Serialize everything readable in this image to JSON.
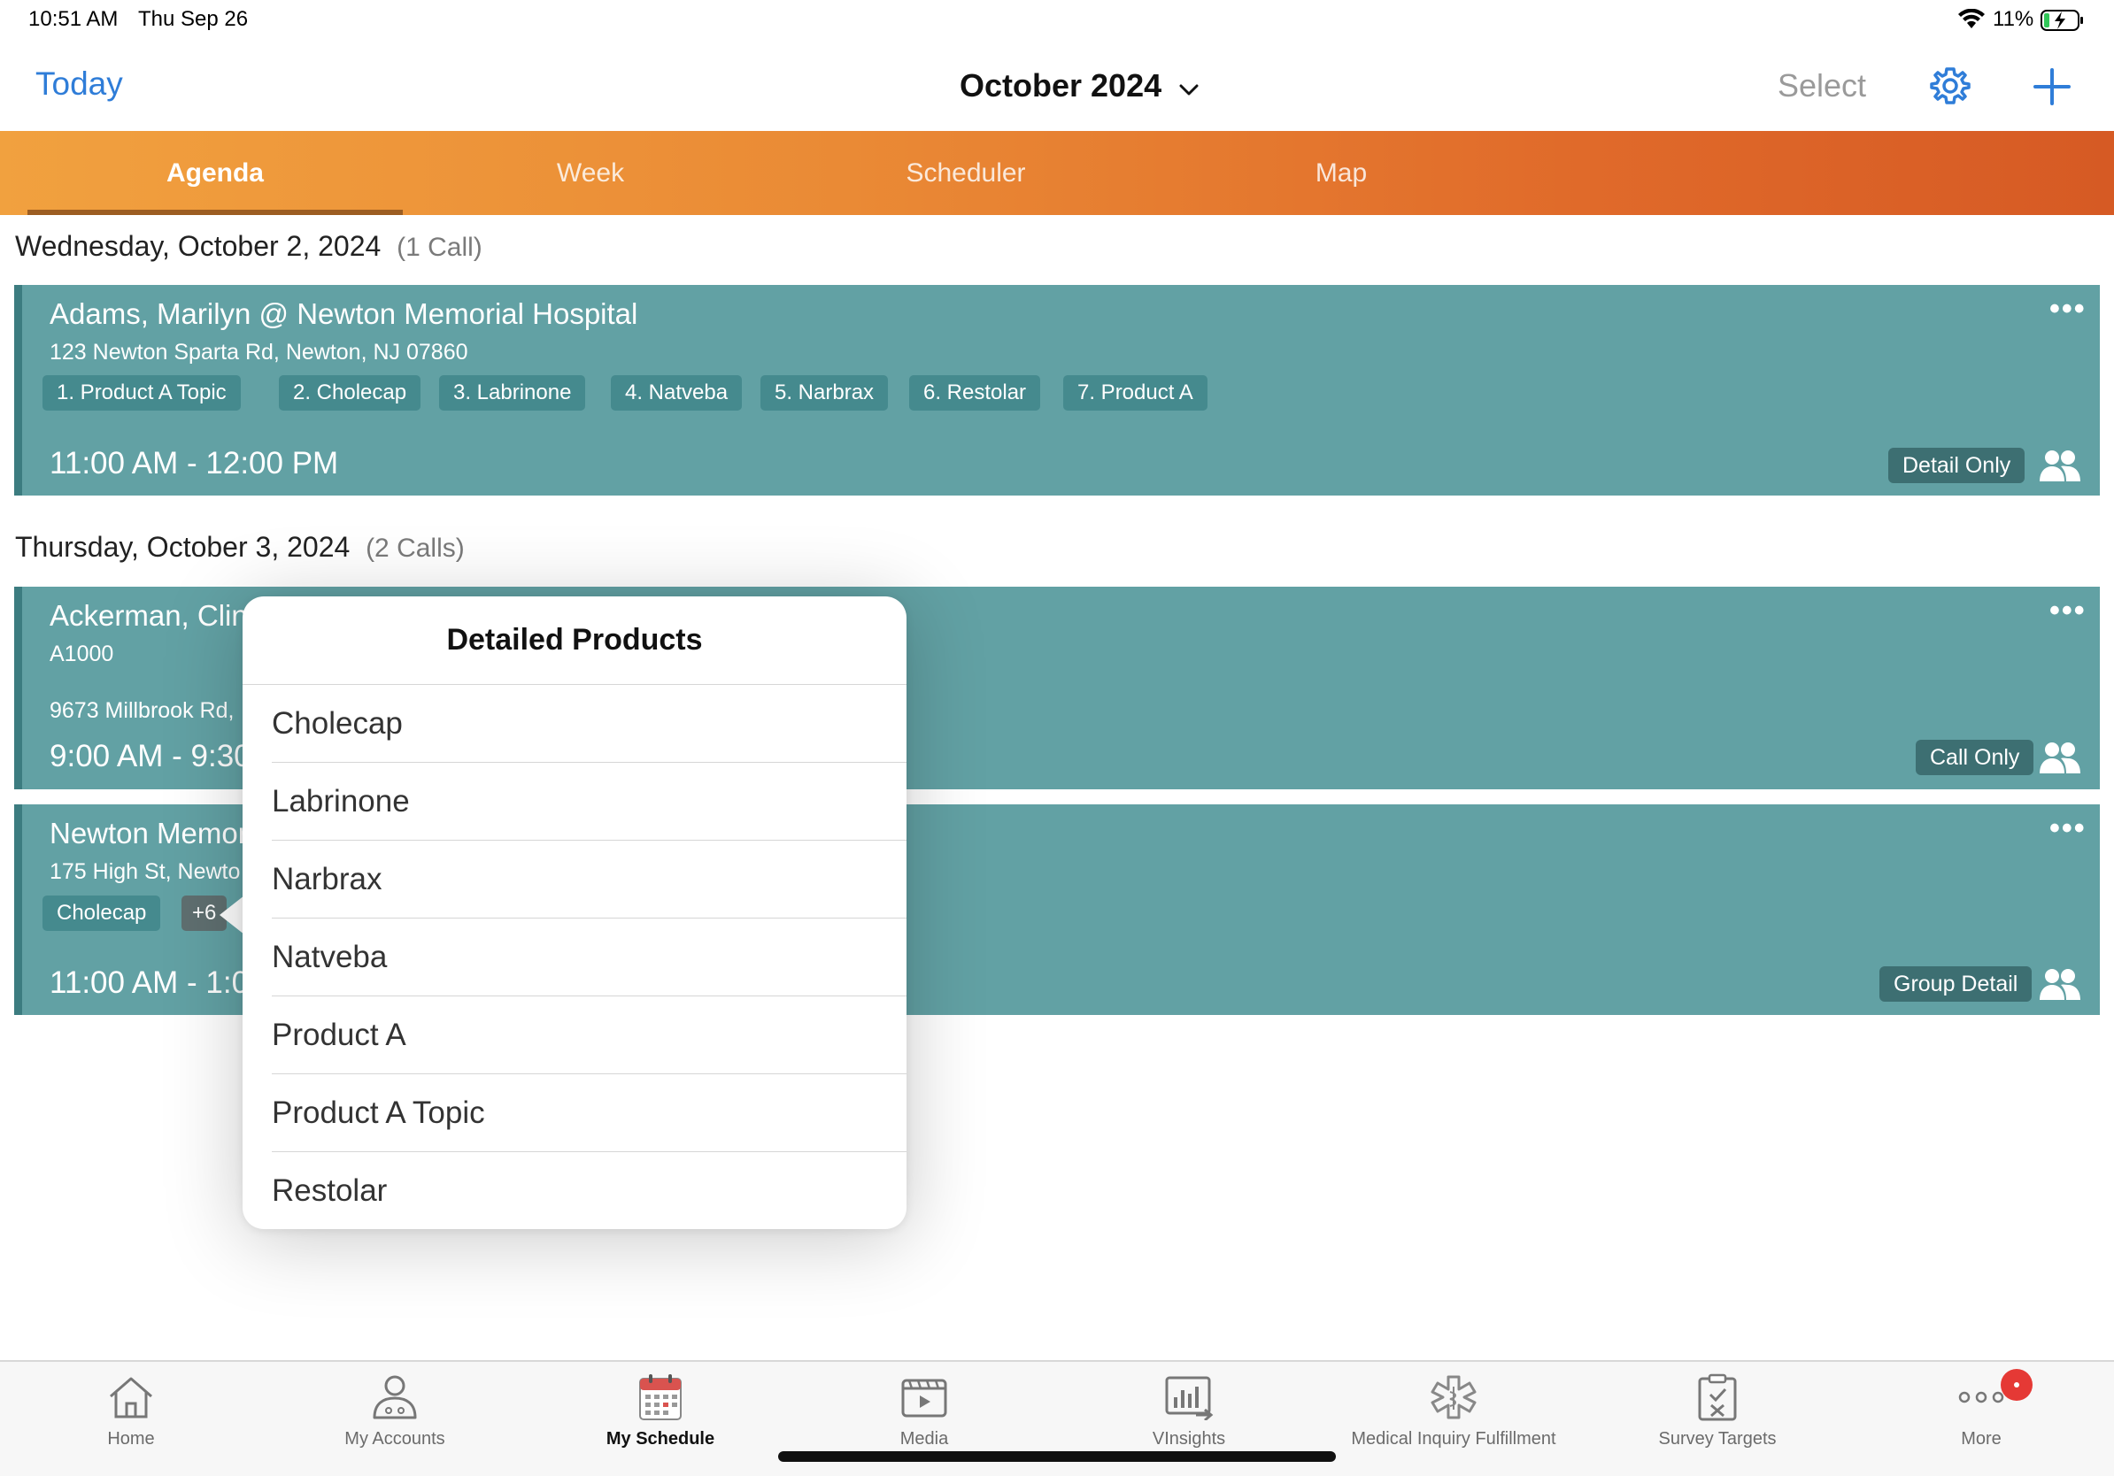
{
  "status_bar": {
    "time": "10:51 AM",
    "date": "Thu Sep 26",
    "battery_percent": "11%",
    "wifi_icon": "wifi-icon",
    "battery_icon": "battery-charging-icon"
  },
  "header": {
    "today_label": "Today",
    "month_title": "October 2024",
    "select_label": "Select",
    "settings_icon": "gear-icon",
    "add_icon": "plus-icon",
    "accent_color": "#2f7dd8"
  },
  "view_tabs": [
    {
      "label": "Agenda",
      "active": true
    },
    {
      "label": "Week",
      "active": false
    },
    {
      "label": "Scheduler",
      "active": false
    },
    {
      "label": "Map",
      "active": false
    }
  ],
  "days": [
    {
      "date_label": "Wednesday, October 2, 2024",
      "count_label": "(1 Call)",
      "calls": [
        {
          "title": "Adams, Marilyn @ Newton Memorial Hospital",
          "address": "123 Newton Sparta Rd, Newton, NJ 07860",
          "chips": [
            "1. Product A Topic",
            "2. Cholecap",
            "3. Labrinone",
            "4. Natveba",
            "5. Narbrax",
            "6. Restolar",
            "7. Product A"
          ],
          "time": "11:00 AM - 12:00 PM",
          "badge": "Detail Only"
        }
      ]
    },
    {
      "date_label": "Thursday, October 3, 2024",
      "count_label": "(2 Calls)",
      "calls": [
        {
          "title": "Ackerman, Clint",
          "id": "A1000",
          "address": "9673 Millbrook Rd,",
          "time": "9:00 AM - 9:30",
          "badge": "Call Only"
        },
        {
          "title": "Newton Memori",
          "address": "175 High St, Newto",
          "chips": [
            "Cholecap",
            "+6"
          ],
          "time": "11:00 AM - 1:00",
          "badge": "Group Detail"
        }
      ]
    }
  ],
  "popover": {
    "title": "Detailed Products",
    "items": [
      "Cholecap",
      "Labrinone",
      "Narbrax",
      "Natveba",
      "Product A",
      "Product A Topic",
      "Restolar"
    ]
  },
  "bottom_tabs": [
    {
      "label": "Home",
      "icon": "home-icon",
      "active": false
    },
    {
      "label": "My Accounts",
      "icon": "person-icon",
      "active": false
    },
    {
      "label": "My Schedule",
      "icon": "calendar-icon",
      "active": true
    },
    {
      "label": "Media",
      "icon": "media-icon",
      "active": false
    },
    {
      "label": "VInsights",
      "icon": "insights-icon",
      "active": false
    },
    {
      "label": "Medical Inquiry Fulfillment",
      "icon": "medical-icon",
      "active": false
    },
    {
      "label": "Survey Targets",
      "icon": "survey-icon",
      "active": false
    },
    {
      "label": "More",
      "icon": "more-icon",
      "active": false,
      "has_notification": true
    }
  ],
  "colors": {
    "card_bg": "#62a1a4",
    "tab_gradient_start": "#f1a13f",
    "tab_gradient_end": "#d65a24",
    "notification": "#e53935"
  }
}
